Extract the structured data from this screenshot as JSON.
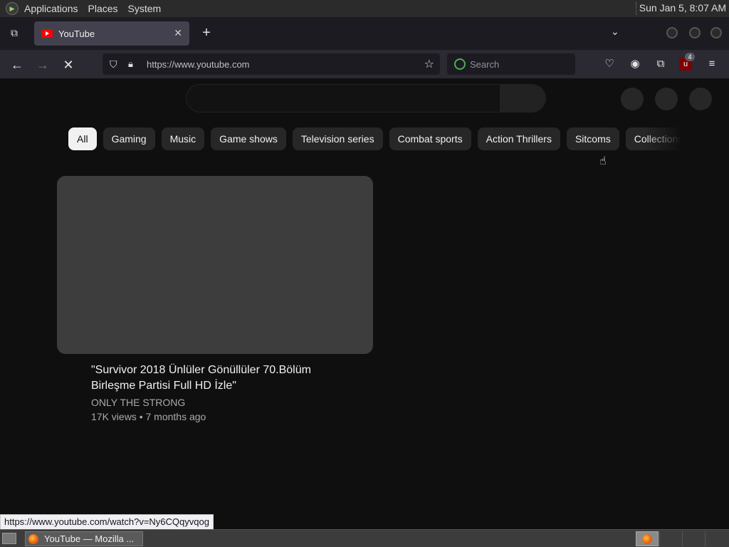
{
  "system_panel": {
    "menus": [
      "Applications",
      "Places",
      "System"
    ],
    "clock": "Sun Jan  5,  8:07 AM"
  },
  "browser": {
    "tab": {
      "title": "YouTube"
    },
    "url": "https://www.youtube.com",
    "search_placeholder": "Search",
    "extension_badge": "4"
  },
  "youtube": {
    "chips": [
      "All",
      "Gaming",
      "Music",
      "Game shows",
      "Television series",
      "Combat sports",
      "Action Thrillers",
      "Sitcoms",
      "Collections"
    ],
    "active_chip": "All",
    "video": {
      "title": "\"Survivor 2018 Ünlüler Gönüllüler 70.Bölüm Birleşme Partisi Full HD İzle\"",
      "channel": "ONLY THE STRONG",
      "meta": "17K views • 7 months ago"
    }
  },
  "status_url": "https://www.youtube.com/watch?v=Ny6CQqyvqog",
  "taskbar": {
    "window_title": "YouTube — Mozilla ..."
  }
}
